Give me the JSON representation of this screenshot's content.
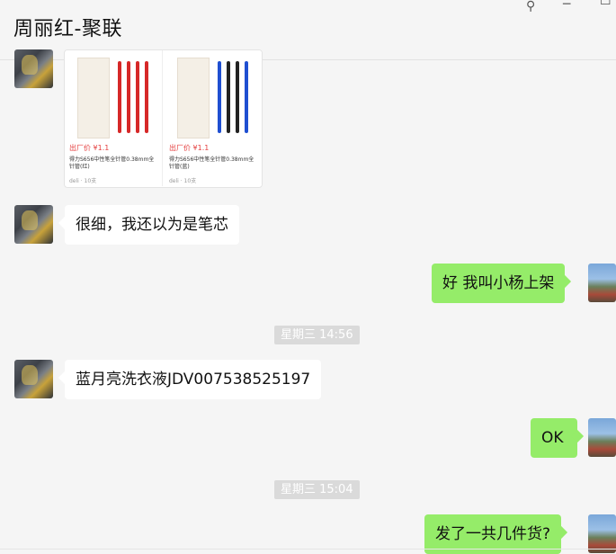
{
  "header": {
    "title": "周丽红-聚联",
    "pin_glyph": "⚲",
    "minimize_glyph": "─",
    "maximize_glyph": "☐"
  },
  "messages": {
    "m1_text": "很细，我还以为是笔芯",
    "m2_text": "好 我叫小杨上架",
    "ts1": "星期三 14:56",
    "m3_text": "蓝月亮洗衣液JDV007538525197",
    "m4_text": "OK",
    "ts2": "星期三 15:04",
    "m5_text": "发了一共几件货?"
  },
  "card": {
    "left_price": "出厂价 ¥1.1",
    "left_desc": "得力S656中性笔全针管0.38mm全针管(红)",
    "left_meta": "deli · 10支",
    "right_price": "出厂价 ¥1.1",
    "right_desc": "得力S656中性笔全针管0.38mm全针管(蓝)",
    "right_meta": "deli · 10支"
  },
  "colors": {
    "bubble_out": "#95ec69",
    "bubble_in": "#ffffff",
    "timestamp_bg": "#dadada",
    "background": "#f5f5f5",
    "pen_red": "#d62828",
    "pen_blue": "#1f4fd1"
  }
}
